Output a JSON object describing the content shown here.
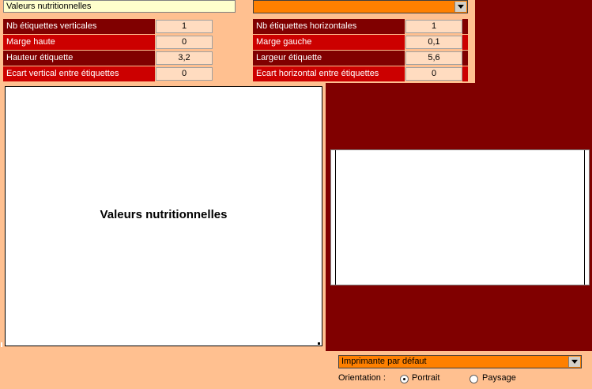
{
  "label_title": "Valeurs nutritionnelles",
  "top_combo": {
    "value": ""
  },
  "fields": {
    "left": [
      {
        "label": "Nb étiquettes verticales",
        "value": "1"
      },
      {
        "label": "Marge haute",
        "value": "0"
      },
      {
        "label": "Hauteur étiquette",
        "value": "3,2"
      },
      {
        "label": "Ecart vertical entre étiquettes",
        "value": "0"
      }
    ],
    "right": [
      {
        "label": "Nb étiquettes horizontales",
        "value": "1"
      },
      {
        "label": "Marge gauche",
        "value": "0,1"
      },
      {
        "label": "Largeur étiquette",
        "value": "5,6"
      },
      {
        "label": "Ecart horizontal entre étiquettes",
        "value": "0"
      }
    ]
  },
  "preview": {
    "text": "Valeurs nutritionnelles"
  },
  "printer": {
    "selected": "Imprimante par défaut"
  },
  "orientation": {
    "label": "Orientation :",
    "options": [
      "Portrait",
      "Paysage"
    ],
    "selected": "Portrait"
  },
  "colors": {
    "background": "#800000",
    "panel": "#ffc090",
    "combo": "#ff8000",
    "row_dark": "#800000",
    "row_red": "#cc0000"
  },
  "icons": [
    "chevron-down-icon",
    "radio-selected-icon",
    "radio-empty-icon"
  ]
}
